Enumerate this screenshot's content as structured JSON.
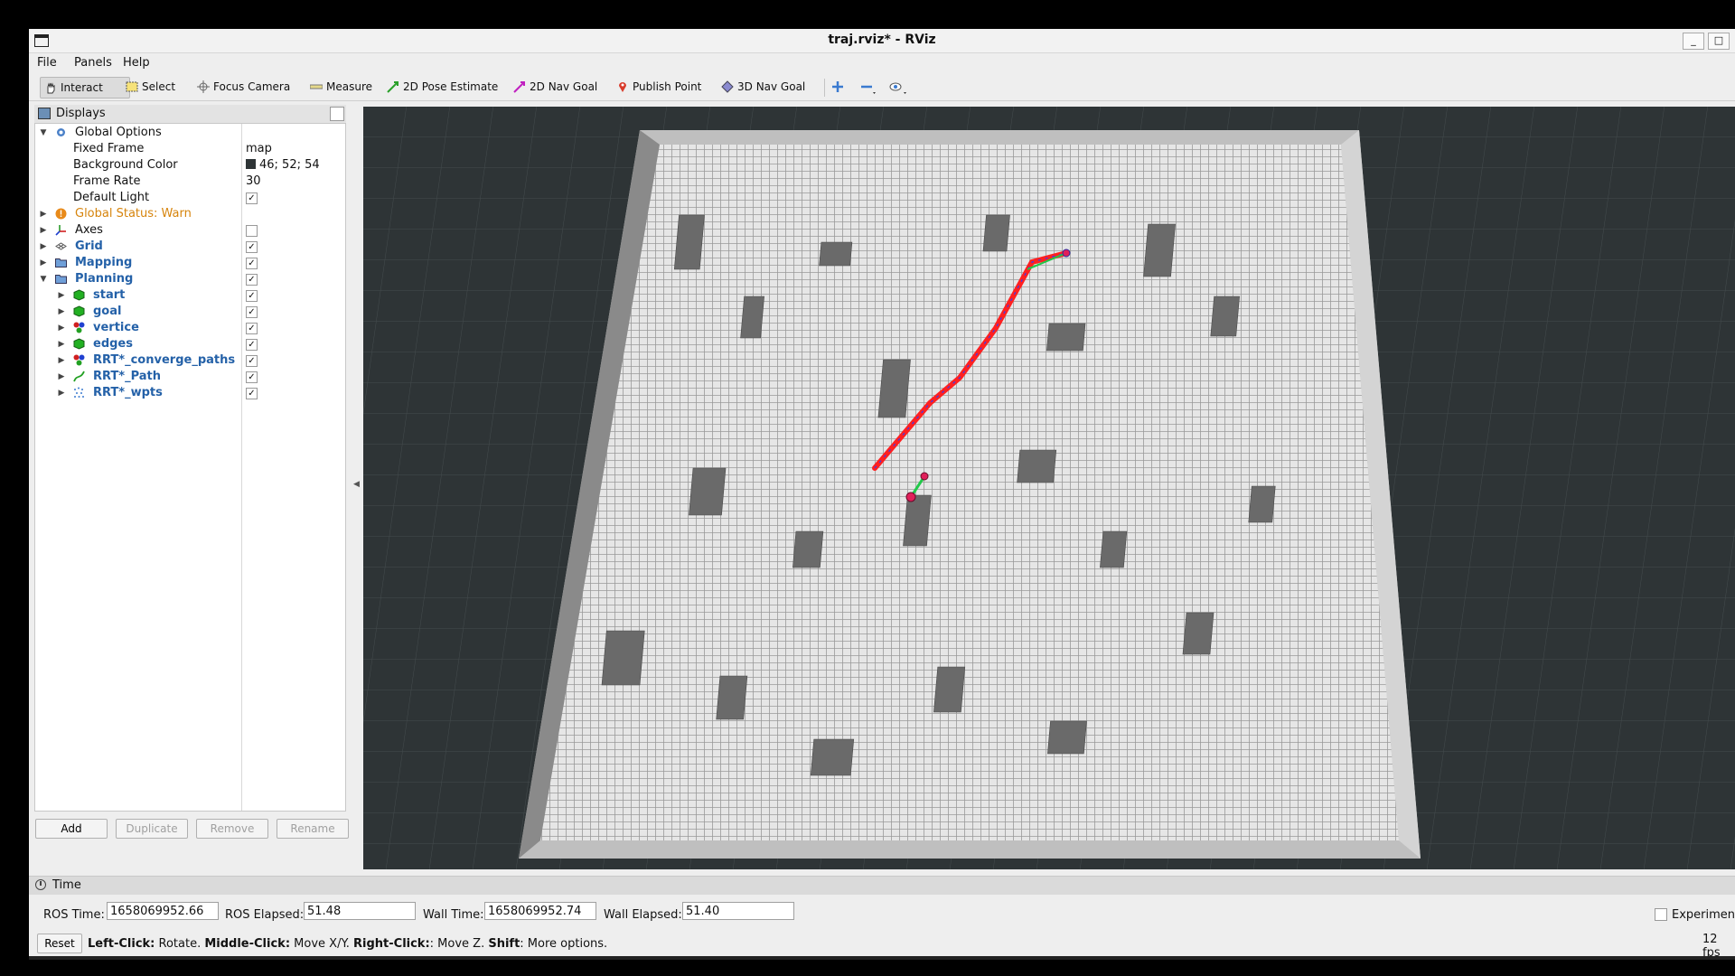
{
  "window": {
    "title": "traj.rviz* - RViz",
    "minimize_label": "_",
    "maximize_label": "□"
  },
  "menu": {
    "file": "File",
    "panels": "Panels",
    "help": "Help"
  },
  "toolbar": {
    "interact": "Interact",
    "select": "Select",
    "focus_camera": "Focus Camera",
    "measure": "Measure",
    "pose_estimate": "2D Pose Estimate",
    "nav_goal_2d": "2D Nav Goal",
    "publish_point": "Publish Point",
    "nav_goal_3d": "3D Nav Goal"
  },
  "displays": {
    "title": "Displays",
    "global_options": "Global Options",
    "fixed_frame_label": "Fixed Frame",
    "fixed_frame_value": "map",
    "background_color_label": "Background Color",
    "background_color_value": "46; 52; 54",
    "frame_rate_label": "Frame Rate",
    "frame_rate_value": "30",
    "default_light_label": "Default Light",
    "global_status": "Global Status: Warn",
    "axes": "Axes",
    "grid": "Grid",
    "mapping": "Mapping",
    "planning": "Planning",
    "start": "start",
    "goal": "goal",
    "vertice": "vertice",
    "edges": "edges",
    "converge_paths": "RRT*_converge_paths",
    "rrt_path": "RRT*_Path",
    "rrt_wpts": "RRT*_wpts",
    "check": "✓",
    "add": "Add",
    "duplicate": "Duplicate",
    "remove": "Remove",
    "rename": "Rename"
  },
  "time": {
    "title": "Time",
    "ros_time_label": "ROS Time:",
    "ros_time": "1658069952.66",
    "ros_elapsed_label": "ROS Elapsed:",
    "ros_elapsed": "51.48",
    "wall_time_label": "Wall Time:",
    "wall_time": "1658069952.74",
    "wall_elapsed_label": "Wall Elapsed:",
    "wall_elapsed": "51.40",
    "experimental": "Experimenta",
    "reset": "Reset",
    "fps": "12 fps"
  },
  "hint": {
    "left_click": "Left-Click:",
    "left_action": " Rotate. ",
    "middle_click": "Middle-Click:",
    "middle_action": " Move X/Y. ",
    "right_click": "Right-Click:",
    "right_action": ": Move Z. ",
    "shift": "Shift",
    "shift_action": ": More options."
  },
  "colors": {
    "viewport_background": "#2e3436",
    "status_warn": "#d6840c",
    "display_label_blue": "#2461a8",
    "path_red": "#ff2020",
    "path_green": "#22c84a"
  }
}
